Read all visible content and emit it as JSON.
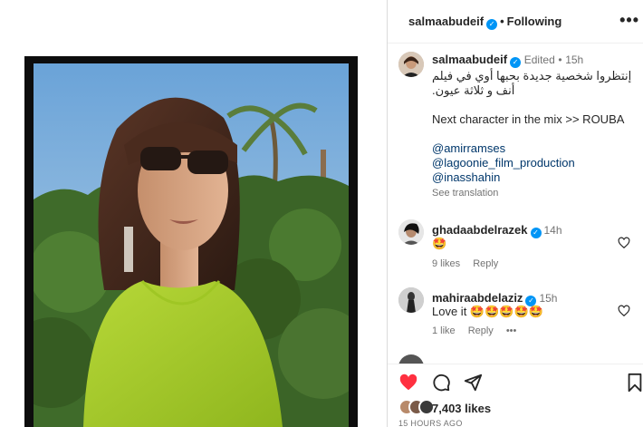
{
  "header": {
    "username": "salmaabudeif",
    "separator": "•",
    "follow_state": "Following",
    "more_icon": "more-horizontal-icon"
  },
  "caption": {
    "username": "salmaabudeif",
    "edited": "Edited",
    "separator": "•",
    "time": "15h",
    "line1": "إنتظروا شخصية جديدة بحبها أوي في فيلم",
    "line2": "أنف و ثلاثة عيون.",
    "line3": "Next character in the mix >> ROUBA",
    "mentions": [
      "@amirramses",
      "@lagoonie_film_production",
      "@inasshahin"
    ],
    "see_translation": "See translation"
  },
  "comments": [
    {
      "username": "ghadaabdelrazek",
      "time": "14h",
      "text": "🤩",
      "likes": "9 likes",
      "reply": "Reply"
    },
    {
      "username": "mahiraabdelaziz",
      "time": "15h",
      "text": "Love it 🤩🤩🤩🤩🤩",
      "likes": "1 like",
      "reply": "Reply",
      "more": "•••"
    }
  ],
  "footer": {
    "likes": "7,403 likes",
    "posted_ago": "15 HOURS AGO"
  },
  "colors": {
    "verified": "#0095f6",
    "liked_heart": "#ff3040",
    "mention": "#00376b",
    "secondary_text": "#737373"
  }
}
